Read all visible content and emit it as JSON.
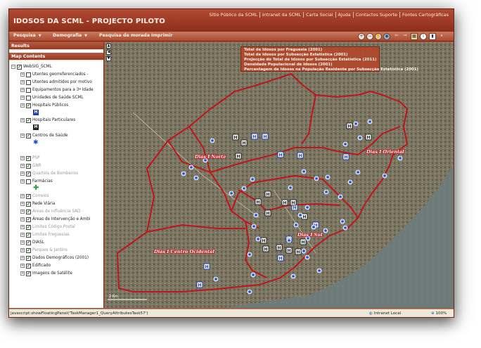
{
  "header": {
    "title": "IDOSOS DA SCML - PROJECTO PILOTO",
    "links": [
      "Sítio Público da SCML",
      "Intranet da SCML",
      "Carta Social",
      "Ajuda",
      "Contactos Suporte",
      "Fontes Cartográficas"
    ]
  },
  "menu": {
    "items": [
      {
        "label": "Pesquisa",
        "has_dropdown": true
      },
      {
        "label": "Demografia",
        "has_dropdown": true
      },
      {
        "label": "Pesquisa de morada",
        "has_dropdown": false
      },
      {
        "label": "Imprimir",
        "has_dropdown": false
      }
    ],
    "tools": [
      "zoom-in-icon",
      "zoom-out-icon",
      "pan-icon",
      "globe-icon",
      "back-icon",
      "forward-icon",
      "full-extent-icon",
      "identify-icon",
      "measure-icon"
    ]
  },
  "panels": {
    "results": "Results",
    "map_contents": "Map Contents"
  },
  "demografia_dropdown": [
    "Total de Idosos por Freguesia (2001)",
    "Total de Idosos por Subsecção Estatística (2001)",
    "Projecção do Total de Idosos por Subsecção Estatística (2011)",
    "Densidade Populacional de Idosos (2001)",
    "Percentagem de Idosos na População Residente por Subsecção Estatística (2001)"
  ],
  "toc": {
    "root": "WebSIG_SCML",
    "layers": [
      {
        "label": "Utentes georreferenciados - ",
        "checked": false,
        "gray": false
      },
      {
        "label": "Utentes admitidos por motivo",
        "checked": false,
        "gray": false
      },
      {
        "label": "Equipamentos para a 3ª Idade",
        "checked": false,
        "gray": false
      },
      {
        "label": "Unidades de Saúde SCML",
        "checked": false,
        "gray": false
      },
      {
        "label": "Hospitais Públicos",
        "checked": true,
        "gray": false
      },
      {
        "label": "Hospitais Particulares",
        "checked": true,
        "gray": false
      },
      {
        "label": "Centros de Saúde",
        "checked": true,
        "gray": false
      },
      {
        "label": "PSP",
        "checked": true,
        "gray": true
      },
      {
        "label": "GNR",
        "checked": true,
        "gray": true
      },
      {
        "label": "Quartéis de Bombeiros",
        "checked": true,
        "gray": true
      },
      {
        "label": "Farmácias",
        "checked": false,
        "gray": false
      },
      {
        "label": "Correios",
        "checked": true,
        "gray": true
      },
      {
        "label": "Rede Viária",
        "checked": true,
        "gray": false
      },
      {
        "label": "Áreas de Influência SAD",
        "checked": true,
        "gray": true
      },
      {
        "label": "Áreas de Intervenção e Ambi",
        "checked": true,
        "gray": false
      },
      {
        "label": "Limites Código Postal",
        "checked": true,
        "gray": true
      },
      {
        "label": "Limites Freguesias",
        "checked": true,
        "gray": true
      },
      {
        "label": "DIASL",
        "checked": true,
        "gray": false
      },
      {
        "label": "Parques & Jardins",
        "checked": true,
        "gray": true
      },
      {
        "label": "Dados Demográficos (2001)",
        "checked": true,
        "gray": false
      },
      {
        "label": "Edificado",
        "checked": true,
        "gray": false
      },
      {
        "label": "Imagens de Satélite",
        "checked": true,
        "gray": false
      }
    ]
  },
  "map": {
    "regions": [
      "Dias I Norte",
      "Dias I Oriental",
      "Dias I Sul",
      "Dias I Centro Ocidental"
    ],
    "scale_label": "2 Km",
    "boundary_color": "#c0151a",
    "hospital_color": "#1f3fb0",
    "health_center_color": "#1f4ccf"
  },
  "statusbar": {
    "text": "javascript:showFloatingPanel('TaskManager1_QueryAttributesTask57')",
    "zone": "Intranet Local",
    "zoom": "100%"
  }
}
